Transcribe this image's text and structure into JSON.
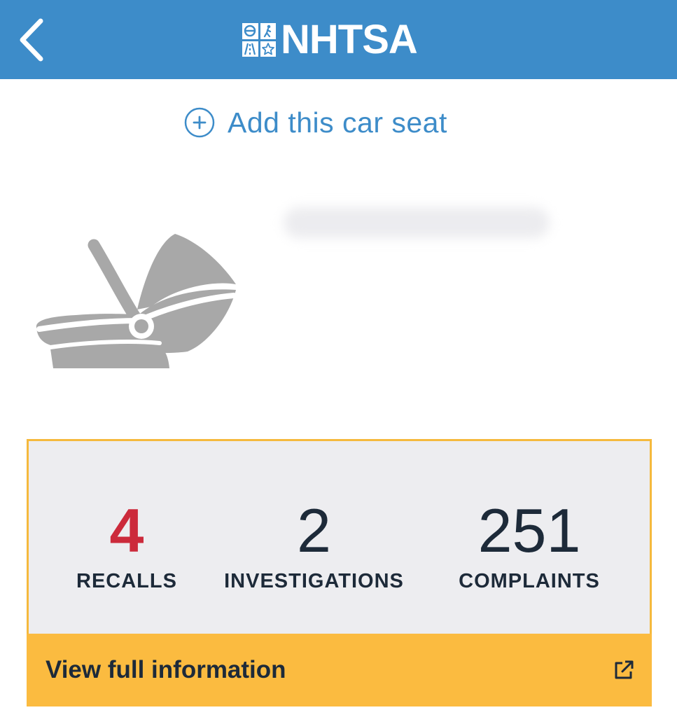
{
  "header": {
    "brand": "NHTSA",
    "back_icon": "chevron-left-icon",
    "background_color": "#3d8cc9"
  },
  "add_action": {
    "label": "Add this car seat",
    "icon": "plus-circle-icon"
  },
  "product": {
    "image_icon": "infant-car-seat-icon"
  },
  "stats": {
    "recalls": {
      "value": "4",
      "label": "RECALLS",
      "color": "#cc2a3b"
    },
    "investigations": {
      "value": "2",
      "label": "INVESTIGATIONS"
    },
    "complaints": {
      "value": "251",
      "label": "COMPLAINTS"
    },
    "border_color": "#f5b93d"
  },
  "footer": {
    "label": "View full information",
    "icon": "external-link-icon",
    "background_color": "#fbbb40"
  }
}
